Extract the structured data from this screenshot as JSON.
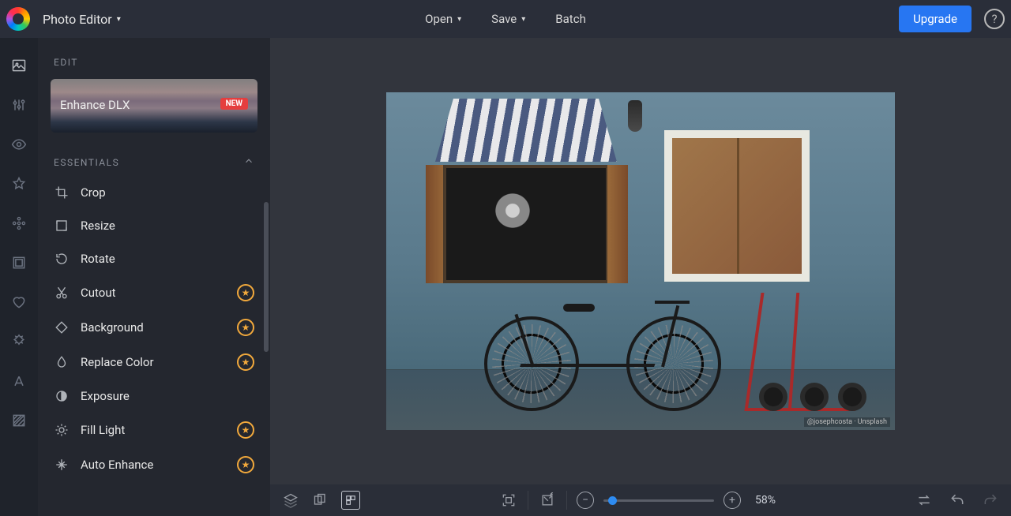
{
  "header": {
    "app_title": "Photo Editor",
    "open_label": "Open",
    "save_label": "Save",
    "batch_label": "Batch",
    "upgrade_label": "Upgrade",
    "help_label": "?"
  },
  "sidebar": {
    "edit_section": "EDIT",
    "enhance_card": {
      "label": "Enhance DLX",
      "badge": "NEW"
    },
    "essentials_section": "ESSENTIALS",
    "tools": [
      {
        "label": "Crop",
        "premium": false,
        "icon": "crop-icon"
      },
      {
        "label": "Resize",
        "premium": false,
        "icon": "resize-icon"
      },
      {
        "label": "Rotate",
        "premium": false,
        "icon": "rotate-icon"
      },
      {
        "label": "Cutout",
        "premium": true,
        "icon": "cutout-icon"
      },
      {
        "label": "Background",
        "premium": true,
        "icon": "background-icon"
      },
      {
        "label": "Replace Color",
        "premium": true,
        "icon": "replace-color-icon"
      },
      {
        "label": "Exposure",
        "premium": false,
        "icon": "exposure-icon"
      },
      {
        "label": "Fill Light",
        "premium": true,
        "icon": "fill-light-icon"
      },
      {
        "label": "Auto Enhance",
        "premium": true,
        "icon": "auto-enhance-icon"
      }
    ]
  },
  "canvas": {
    "credit": "@josephcosta · Unsplash"
  },
  "bottombar": {
    "zoom_text": "58%"
  }
}
